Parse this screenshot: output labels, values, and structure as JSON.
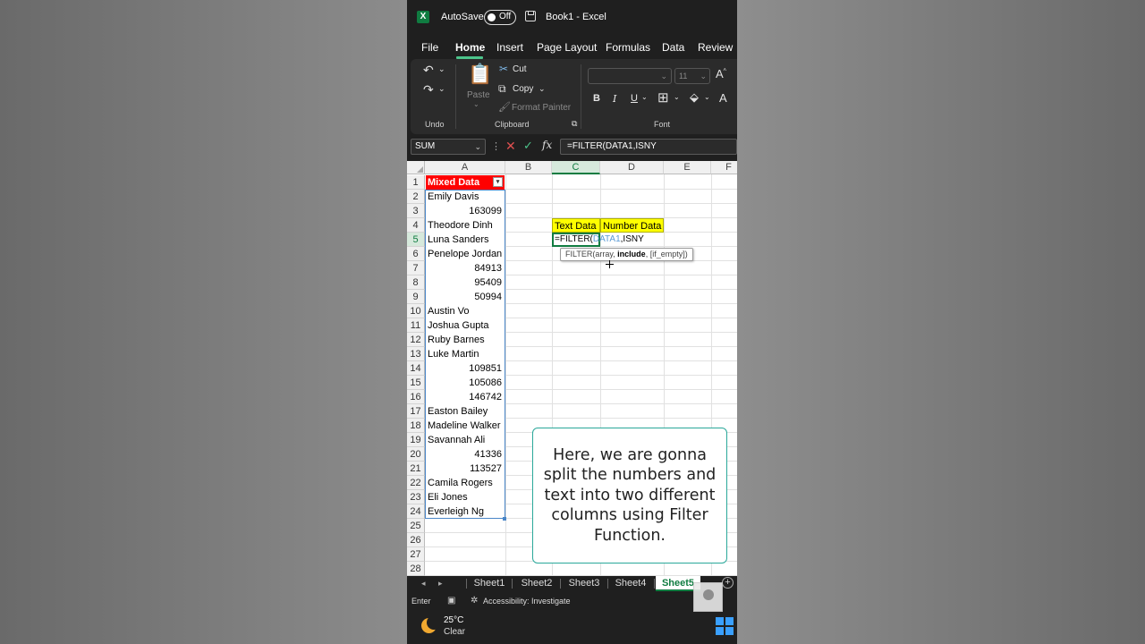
{
  "window": {
    "autosave_label": "AutoSave",
    "autosave_state": "Off",
    "doc_title": "Book1  -  Excel"
  },
  "menu": {
    "tabs": [
      "File",
      "Home",
      "Insert",
      "Page Layout",
      "Formulas",
      "Data",
      "Review"
    ],
    "active": "Home"
  },
  "ribbon": {
    "undo_group": "Undo",
    "paste_label": "Paste",
    "cut_label": "Cut",
    "copy_label": "Copy",
    "format_painter_label": "Format Painter",
    "clipboard_group": "Clipboard",
    "font_group": "Font",
    "font_size": "11",
    "bold": "B",
    "italic": "I",
    "underline": "U",
    "grow_font": "A",
    "font_color": "A"
  },
  "formula_bar": {
    "name_box": "SUM",
    "formula": "=FILTER(DATA1,ISNY"
  },
  "grid": {
    "columns": [
      "A",
      "B",
      "C",
      "D",
      "E",
      "F"
    ],
    "selected_column": "C",
    "rows": [
      "1",
      "2",
      "3",
      "4",
      "5",
      "6",
      "7",
      "8",
      "9",
      "10",
      "11",
      "12",
      "13",
      "14",
      "15",
      "16",
      "17",
      "18",
      "19",
      "20",
      "21",
      "22",
      "23",
      "24",
      "25",
      "26",
      "27",
      "28"
    ],
    "selected_row": "5",
    "header": "Mixed Data",
    "column_a": [
      {
        "value": "Emily Davis",
        "num": false
      },
      {
        "value": "163099",
        "num": true
      },
      {
        "value": "Theodore Dinh",
        "num": false
      },
      {
        "value": "Luna Sanders",
        "num": false
      },
      {
        "value": "Penelope Jordan",
        "num": false
      },
      {
        "value": "84913",
        "num": true
      },
      {
        "value": "95409",
        "num": true
      },
      {
        "value": "50994",
        "num": true
      },
      {
        "value": "Austin Vo",
        "num": false
      },
      {
        "value": "Joshua Gupta",
        "num": false
      },
      {
        "value": "Ruby Barnes",
        "num": false
      },
      {
        "value": "Luke Martin",
        "num": false
      },
      {
        "value": "109851",
        "num": true
      },
      {
        "value": "105086",
        "num": true
      },
      {
        "value": "146742",
        "num": true
      },
      {
        "value": "Easton Bailey",
        "num": false
      },
      {
        "value": "Madeline Walker",
        "num": false
      },
      {
        "value": "Savannah Ali",
        "num": false
      },
      {
        "value": "41336",
        "num": true
      },
      {
        "value": "113527",
        "num": true
      },
      {
        "value": "Camila Rogers",
        "num": false
      },
      {
        "value": "Eli Jones",
        "num": false
      },
      {
        "value": "Everleigh Ng",
        "num": false
      }
    ],
    "text_data_label": "Text Data",
    "number_data_label": "Number Data",
    "formula_prefix": "=FILTER(",
    "formula_arg": "DATA1",
    "formula_suffix": ",ISNY",
    "tooltip_prefix": "FILTER(array, ",
    "tooltip_bold": "include",
    "tooltip_suffix": ", [if_empty])"
  },
  "note": "Here, we are gonna split the numbers and text into two different columns using Filter Function.",
  "sheets": {
    "tabs": [
      "Sheet1",
      "Sheet2",
      "Sheet3",
      "Sheet4",
      "Sheet5"
    ],
    "active": "Sheet5"
  },
  "status": {
    "mode": "Enter",
    "accessibility": "Accessibility: Investigate"
  },
  "taskbar": {
    "temperature": "25°C",
    "condition": "Clear"
  }
}
